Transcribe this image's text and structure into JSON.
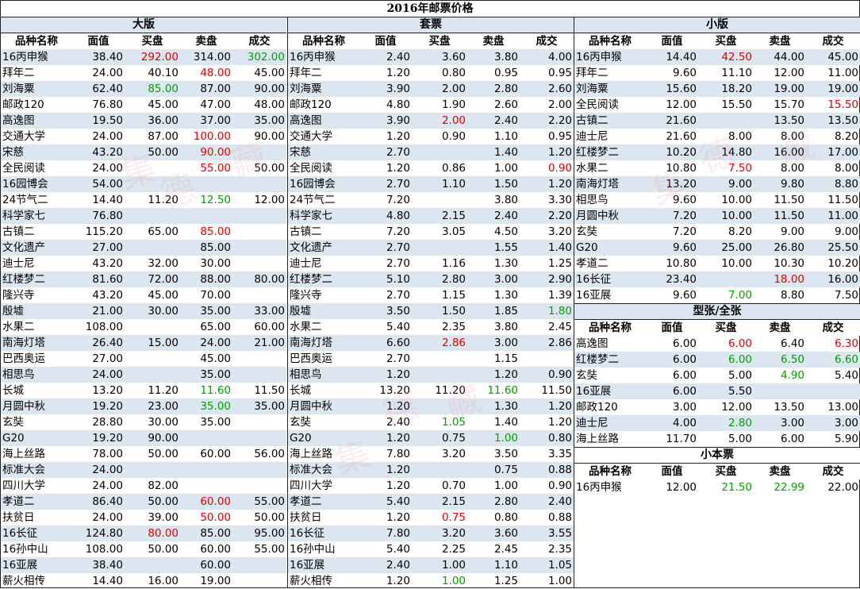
{
  "title": "2016年邮票价格",
  "headers": [
    "品种名称",
    "面值",
    "买盘",
    "卖盘",
    "成交"
  ],
  "watermark": [
    "集",
    "德",
    "藏",
    "集",
    "德",
    "藏",
    "集",
    "德",
    "藏"
  ],
  "sections": {
    "daban": {
      "title": "大版",
      "rows": [
        [
          "16丙申猴",
          "38.40",
          "292.00",
          "314.00",
          "302.00"
        ],
        [
          "拜年二",
          "24.00",
          "40.10",
          "48.00",
          "45.00"
        ],
        [
          "刘海粟",
          "62.40",
          "85.00",
          "87.00",
          "90.00"
        ],
        [
          "邮政120",
          "76.80",
          "45.00",
          "47.00",
          "48.00"
        ],
        [
          "高逸图",
          "19.50",
          "36.00",
          "37.00",
          "35.00"
        ],
        [
          "交通大学",
          "24.00",
          "87.00",
          "100.00",
          "90.00"
        ],
        [
          "宋慈",
          "43.20",
          "50.00",
          "90.00",
          ""
        ],
        [
          "全民阅读",
          "24.00",
          "",
          "55.00",
          "50.00"
        ],
        [
          "16园博会",
          "54.00",
          "",
          "",
          ""
        ],
        [
          "24节气二",
          "14.40",
          "11.20",
          "12.50",
          "12.00"
        ],
        [
          "科学家七",
          "76.80",
          "",
          "",
          ""
        ],
        [
          "古镇二",
          "115.20",
          "65.00",
          "85.00",
          ""
        ],
        [
          "文化遗产",
          "27.00",
          "",
          "85.00",
          ""
        ],
        [
          "迪士尼",
          "43.20",
          "32.00",
          "30.00",
          ""
        ],
        [
          "红楼梦二",
          "81.60",
          "72.00",
          "88.00",
          "80.00"
        ],
        [
          "隆兴寺",
          "43.20",
          "45.00",
          "70.00",
          ""
        ],
        [
          "殷墟",
          "21.00",
          "30.00",
          "35.00",
          "33.00"
        ],
        [
          "水果二",
          "108.00",
          "",
          "65.00",
          "60.00"
        ],
        [
          "南海灯塔",
          "26.40",
          "15.00",
          "24.00",
          "21.00"
        ],
        [
          "巴西奥运",
          "27.00",
          "",
          "45.00",
          ""
        ],
        [
          "相思鸟",
          "24.00",
          "",
          "35.00",
          ""
        ],
        [
          "长城",
          "13.20",
          "11.20",
          "11.60",
          "11.50"
        ],
        [
          "月圆中秋",
          "19.20",
          "23.00",
          "35.00",
          "35.00"
        ],
        [
          "玄奘",
          "28.80",
          "30.00",
          "35.00",
          ""
        ],
        [
          "G20",
          "19.20",
          "90.00",
          "",
          ""
        ],
        [
          "海上丝路",
          "78.00",
          "50.00",
          "60.00",
          "56.00"
        ],
        [
          "标准大会",
          "24.00",
          "",
          "",
          ""
        ],
        [
          "四川大学",
          "24.00",
          "82.00",
          "",
          ""
        ],
        [
          "孝道二",
          "86.40",
          "50.00",
          "60.00",
          "55.00"
        ],
        [
          "扶贫日",
          "24.00",
          "39.00",
          "50.00",
          "50.00"
        ],
        [
          "16长征",
          "124.80",
          "80.00",
          "85.00",
          "95.00"
        ],
        [
          "16孙中山",
          "108.00",
          "50.00",
          "60.00",
          "55.00"
        ],
        [
          "16亚展",
          "38.40",
          "",
          "60.00",
          ""
        ],
        [
          "薪火相传",
          "14.40",
          "16.00",
          "19.00",
          ""
        ]
      ],
      "colors": {
        "0-2": "red",
        "0-4": "green",
        "1-3": "red",
        "2-2": "green",
        "5-3": "red",
        "6-3": "red",
        "7-3": "red",
        "9-3": "green",
        "11-3": "red",
        "21-3": "green",
        "22-3": "green",
        "28-3": "red",
        "29-3": "red",
        "30-2": "red"
      }
    },
    "taopiao": {
      "title": "套票",
      "rows": [
        [
          "16丙申猴",
          "2.40",
          "3.60",
          "3.80",
          "4.00"
        ],
        [
          "拜年二",
          "1.20",
          "0.80",
          "0.95",
          "0.95"
        ],
        [
          "刘海粟",
          "3.90",
          "2.00",
          "2.80",
          "2.60"
        ],
        [
          "邮政120",
          "4.80",
          "1.90",
          "2.60",
          "2.00"
        ],
        [
          "高逸图",
          "3.90",
          "2.00",
          "2.40",
          "2.20"
        ],
        [
          "交通大学",
          "1.20",
          "0.90",
          "1.10",
          "0.95"
        ],
        [
          "宋慈",
          "2.70",
          "",
          "1.40",
          "1.20"
        ],
        [
          "全民阅读",
          "1.20",
          "0.86",
          "1.00",
          "0.90"
        ],
        [
          "16园博会",
          "2.70",
          "1.10",
          "1.50",
          "1.20"
        ],
        [
          "24节气二",
          "7.20",
          "",
          "3.80",
          "3.30"
        ],
        [
          "科学家七",
          "4.80",
          "2.15",
          "2.40",
          "2.20"
        ],
        [
          "古镇二",
          "7.20",
          "3.05",
          "4.50",
          "3.20"
        ],
        [
          "文化遗产",
          "2.70",
          "",
          "1.55",
          "1.40"
        ],
        [
          "迪士尼",
          "2.70",
          "1.16",
          "1.30",
          "1.25"
        ],
        [
          "红楼梦二",
          "5.10",
          "2.80",
          "3.00",
          "2.90"
        ],
        [
          "隆兴寺",
          "2.70",
          "1.15",
          "1.30",
          "1.39"
        ],
        [
          "殷墟",
          "3.50",
          "1.50",
          "1.85",
          "1.80"
        ],
        [
          "水果二",
          "5.40",
          "2.35",
          "3.80",
          "2.45"
        ],
        [
          "南海灯塔",
          "6.60",
          "2.86",
          "3.00",
          "2.86"
        ],
        [
          "巴西奥运",
          "2.70",
          "",
          "1.15",
          ""
        ],
        [
          "相思鸟",
          "1.20",
          "",
          "1.20",
          "0.90"
        ],
        [
          "长城",
          "13.20",
          "11.20",
          "11.60",
          "11.50"
        ],
        [
          "月圆中秋",
          "1.20",
          "",
          "1.30",
          "1.20"
        ],
        [
          "玄奘",
          "2.40",
          "1.05",
          "1.40",
          "1.20"
        ],
        [
          "G20",
          "1.20",
          "0.75",
          "1.00",
          "0.80"
        ],
        [
          "海上丝路",
          "7.80",
          "3.20",
          "3.50",
          "3.35"
        ],
        [
          "标准大会",
          "1.20",
          "",
          "0.75",
          "0.88"
        ],
        [
          "四川大学",
          "1.20",
          "0.70",
          "1.00",
          "0.90"
        ],
        [
          "孝道二",
          "5.40",
          "2.15",
          "2.80",
          "2.40"
        ],
        [
          "扶贫日",
          "1.20",
          "0.75",
          "0.80",
          "0.88"
        ],
        [
          "16长征",
          "7.80",
          "3.20",
          "3.60",
          "3.55"
        ],
        [
          "16孙中山",
          "5.40",
          "2.25",
          "2.45",
          "2.35"
        ],
        [
          "16亚展",
          "2.40",
          "1.00",
          "1.10",
          "1.05"
        ],
        [
          "薪火相传",
          "1.20",
          "1.00",
          "1.25",
          "1.00"
        ]
      ],
      "colors": {
        "4-2": "red",
        "7-4": "red",
        "16-4": "green",
        "18-2": "red",
        "21-3": "green",
        "23-2": "green",
        "24-3": "green",
        "29-2": "red",
        "33-2": "green"
      }
    },
    "xiaoban": {
      "title": "小版",
      "rows": [
        [
          "16丙申猴",
          "14.40",
          "42.50",
          "44.00",
          "45.00"
        ],
        [
          "拜年二",
          "9.60",
          "11.10",
          "12.00",
          "11.00"
        ],
        [
          "刘海粟",
          "15.60",
          "18.20",
          "19.00",
          "19.00"
        ],
        [
          "全民阅读",
          "12.00",
          "15.50",
          "15.70",
          "15.50"
        ],
        [
          "古镇二",
          "21.60",
          "",
          "13.50",
          "13.50"
        ],
        [
          "迪士尼",
          "21.60",
          "8.00",
          "8.00",
          "8.20"
        ],
        [
          "红楼梦二",
          "10.20",
          "14.80",
          "16.00",
          "17.00"
        ],
        [
          "水果二",
          "10.80",
          "7.50",
          "8.00",
          "8.00"
        ],
        [
          "南海灯塔",
          "13.20",
          "9.00",
          "9.80",
          "8.80"
        ],
        [
          "相思鸟",
          "9.60",
          "10.00",
          "11.50",
          "11.50"
        ],
        [
          "月圆中秋",
          "7.20",
          "10.00",
          "11.50",
          "11.00"
        ],
        [
          "玄奘",
          "7.20",
          "8.20",
          "9.00",
          "9.00"
        ],
        [
          "G20",
          "9.60",
          "25.00",
          "26.80",
          "25.50"
        ],
        [
          "孝道二",
          "10.80",
          "10.00",
          "10.30",
          "10.20"
        ],
        [
          "16长征",
          "23.40",
          "",
          "18.00",
          "16.00"
        ],
        [
          "16亚展",
          "9.60",
          "7.00",
          "8.80",
          "7.50"
        ]
      ],
      "colors": {
        "0-2": "red",
        "3-4": "red",
        "7-2": "red",
        "14-3": "red",
        "15-2": "green"
      }
    },
    "xingzhang": {
      "title": "型张/全张",
      "rows": [
        [
          "高逸图",
          "6.00",
          "6.00",
          "6.40",
          "6.30"
        ],
        [
          "红楼梦二",
          "6.00",
          "6.00",
          "6.50",
          "6.60"
        ],
        [
          "玄奘",
          "6.00",
          "5.00",
          "4.90",
          "5.40"
        ],
        [
          "16亚展",
          "6.00",
          "5.50",
          "",
          ""
        ],
        [
          "邮政120",
          "3.00",
          "12.00",
          "13.50",
          "13.00"
        ],
        [
          "迪士尼",
          "4.00",
          "2.80",
          "3.00",
          "3.00"
        ],
        [
          "海上丝路",
          "11.70",
          "5.00",
          "6.00",
          "5.90"
        ]
      ],
      "colors": {
        "0-2": "red",
        "0-4": "red",
        "1-2": "green",
        "1-3": "green",
        "1-4": "green",
        "2-3": "green",
        "5-2": "green"
      }
    },
    "xiaoben": {
      "title": "小本票",
      "rows": [
        [
          "16丙申猴",
          "12.00",
          "21.50",
          "22.99",
          "22.00"
        ]
      ],
      "colors": {
        "0-2": "green",
        "0-3": "green"
      }
    }
  }
}
